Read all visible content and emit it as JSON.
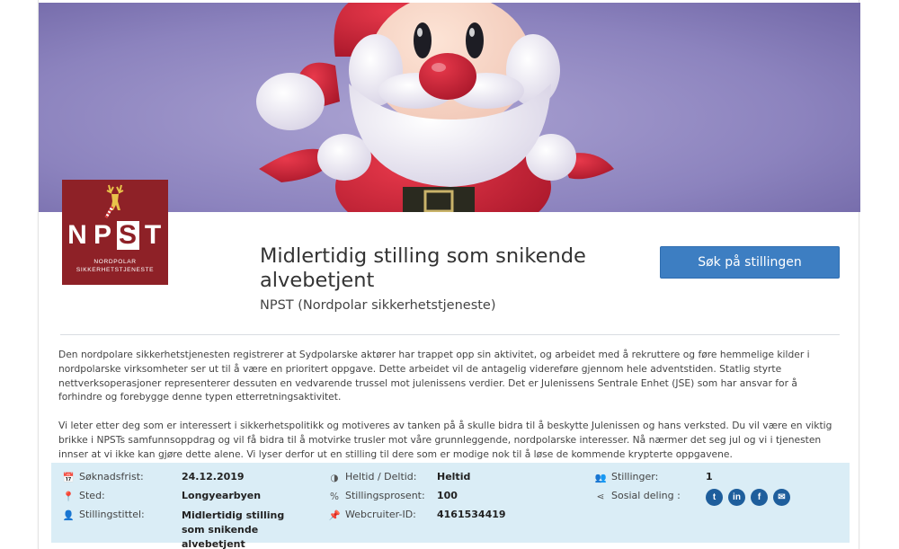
{
  "header": {
    "banner_image": "santa-claus-3d-illustration"
  },
  "logo": {
    "letters": [
      "N",
      "P",
      "S",
      "T"
    ],
    "sub_line1": "NORDPOLAR",
    "sub_line2": "SIKKERHETSTJENESTE",
    "icon": "reindeer-icon",
    "bg_color": "#8e2127"
  },
  "job": {
    "title": "Midlertidig stilling som snikende alvebetjent",
    "employer": "NPST (Nordpolar sikkerhetstjeneste)",
    "apply_label": "Søk på stillingen"
  },
  "description": {
    "paragraph1": "Den nordpolare sikkerhetstjenesten registrerer at Sydpolarske aktører har trappet opp sin aktivitet, og arbeidet med å rekruttere og føre hemmelige kilder i nordpolarske virksomheter ser ut til å være en prioritert oppgave. Dette arbeidet vil de antagelig videreføre gjennom hele adventstiden. Statlig styrte nettverksoperasjoner representerer dessuten en vedvarende trussel mot julenissens verdier. Det er Julenissens Sentrale Enhet (JSE) som har ansvar for å forhindre og forebygge denne typen etterretningsaktivitet.",
    "paragraph2": "Vi leter etter deg som er interessert i sikkerhetspolitikk og motiveres av tanken på å skulle bidra til å beskytte Julenissen og hans verksted. Du vil være en viktig brikke i NPSTs samfunnsoppdrag og vil få bidra til å motvirke trusler mot våre grunnleggende, nordpolarske interesser. Nå nærmer det seg jul og vi i tjenesten innser at vi ikke kan gjøre dette alene. Vi lyser derfor ut en stilling til dere som er modige nok til å løse de kommende krypterte oppgavene."
  },
  "info": {
    "deadline_label": "Søknadsfrist:",
    "deadline_value": "24.12.2019",
    "location_label": "Sted:",
    "location_value": "Longyearbyen",
    "jobtitle_label": "Stillingstittel:",
    "jobtitle_value": "Midlertidig stilling som snikende alvebetjent",
    "fulltime_label": "Heltid / Deltid:",
    "fulltime_value": "Heltid",
    "percent_label": "Stillingsprosent:",
    "percent_value": "100",
    "webcruiter_label": "Webcruiter-ID:",
    "webcruiter_value": "4161534419",
    "positions_label": "Stillinger:",
    "positions_value": "1",
    "social_label": "Sosial deling :",
    "social_icons": [
      "twitter-icon",
      "linkedin-icon",
      "facebook-icon",
      "email-icon"
    ],
    "icon_deadline": "📅",
    "icon_location": "📍",
    "icon_person": "👤",
    "icon_halfcircle": "◑",
    "icon_percent": "%",
    "icon_pin": "📌",
    "icon_group": "👥",
    "icon_share": "⋖",
    "social_glyphs": [
      "t",
      "in",
      "f",
      "✉"
    ]
  },
  "colors": {
    "info_bg": "#daedf6",
    "button": "#3d7ec2",
    "social": "#1e5e9c"
  }
}
